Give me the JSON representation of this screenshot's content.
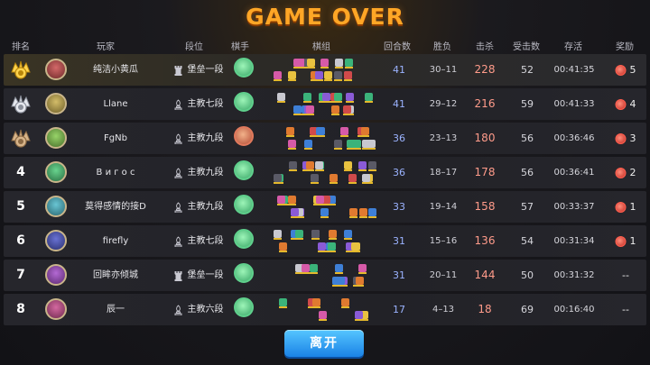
{
  "title": "GAME OVER",
  "columns": {
    "rank": "排名",
    "player": "玩家",
    "tier": "段位",
    "chess": "棋手",
    "lineup": "棋组",
    "rounds": "回合数",
    "winloss": "胜负",
    "kills": "击杀",
    "damage_taken": "受击数",
    "survival": "存活",
    "reward": "奖励"
  },
  "players": [
    {
      "rank": "1",
      "medal": "gold",
      "name": "纯洁小黄瓜",
      "tier": "堡垒一段",
      "tier_icon": "castle-icon",
      "chess_icon": "green-slime",
      "rounds": "41",
      "winloss": "30–11",
      "kills": "228",
      "damage": "52",
      "survival": "00:41:35",
      "reward": "5"
    },
    {
      "rank": "2",
      "medal": "silver",
      "name": "Llane",
      "tier": "主教七段",
      "tier_icon": "bishop-icon",
      "chess_icon": "green-slime",
      "rounds": "41",
      "winloss": "29–12",
      "kills": "216",
      "damage": "59",
      "survival": "00:41:33",
      "reward": "4"
    },
    {
      "rank": "3",
      "medal": "bronze",
      "name": "FgNb",
      "tier": "主教九段",
      "tier_icon": "bishop-icon",
      "chess_icon": "red-warrior",
      "rounds": "36",
      "winloss": "23–13",
      "kills": "180",
      "damage": "56",
      "survival": "00:36:46",
      "reward": "3"
    },
    {
      "rank": "4",
      "medal": "",
      "name": "В и г о с",
      "tier": "主教九段",
      "tier_icon": "bishop-icon",
      "chess_icon": "green-slime",
      "rounds": "36",
      "winloss": "18–17",
      "kills": "178",
      "damage": "56",
      "survival": "00:36:41",
      "reward": "2"
    },
    {
      "rank": "5",
      "medal": "",
      "name": "莫得感情的接D",
      "tier": "主教九段",
      "tier_icon": "bishop-icon",
      "chess_icon": "green-slime",
      "rounds": "33",
      "winloss": "19–14",
      "kills": "158",
      "damage": "57",
      "survival": "00:33:37",
      "reward": "1"
    },
    {
      "rank": "6",
      "medal": "",
      "name": "firefly",
      "tier": "主教七段",
      "tier_icon": "bishop-icon",
      "chess_icon": "green-slime",
      "rounds": "31",
      "winloss": "15–16",
      "kills": "136",
      "damage": "54",
      "survival": "00:31:34",
      "reward": "1"
    },
    {
      "rank": "7",
      "medal": "",
      "name": "回眸亦倾城",
      "tier": "堡垒一段",
      "tier_icon": "castle-icon",
      "chess_icon": "green-slime",
      "rounds": "31",
      "winloss": "20–11",
      "kills": "144",
      "damage": "50",
      "survival": "00:31:32",
      "reward": "--"
    },
    {
      "rank": "8",
      "medal": "",
      "name": "辰一",
      "tier": "主教六段",
      "tier_icon": "bishop-icon",
      "chess_icon": "green-slime",
      "rounds": "17",
      "winloss": "4–13",
      "kills": "18",
      "damage": "69",
      "survival": "00:16:40",
      "reward": "--"
    }
  ],
  "leave_button": "离开",
  "colors": {
    "title": "#ffa626",
    "kills": "#ff9b8a",
    "rounds": "#9bb3ff",
    "button": "#1a82e6"
  }
}
